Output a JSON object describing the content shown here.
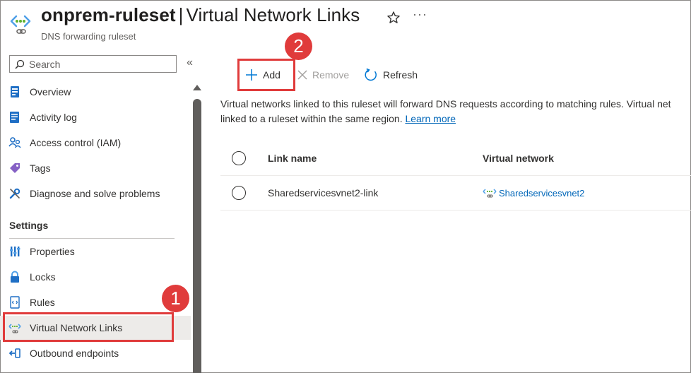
{
  "header": {
    "resource_name": "onprem-ruleset",
    "separator": "|",
    "page_name": "Virtual Network Links",
    "subtitle": "DNS forwarding ruleset",
    "more_label": "···"
  },
  "sidebar": {
    "search_placeholder": "Search",
    "collapse_label": "«",
    "items": [
      {
        "label": "Overview",
        "icon": "overview-icon"
      },
      {
        "label": "Activity log",
        "icon": "activity-log-icon"
      },
      {
        "label": "Access control (IAM)",
        "icon": "iam-icon"
      },
      {
        "label": "Tags",
        "icon": "tag-icon"
      },
      {
        "label": "Diagnose and solve problems",
        "icon": "wrench-icon"
      }
    ],
    "settings_title": "Settings",
    "settings_items": [
      {
        "label": "Properties",
        "icon": "properties-icon"
      },
      {
        "label": "Locks",
        "icon": "lock-icon"
      },
      {
        "label": "Rules",
        "icon": "rules-icon"
      },
      {
        "label": "Virtual Network Links",
        "icon": "vnet-link-icon",
        "active": true
      },
      {
        "label": "Outbound endpoints",
        "icon": "outbound-endpoint-icon"
      }
    ]
  },
  "toolbar": {
    "add_label": "Add",
    "remove_label": "Remove",
    "refresh_label": "Refresh"
  },
  "content": {
    "description_line1": "Virtual networks linked to this ruleset will forward DNS requests according to matching rules. Virtual net",
    "description_line2": "linked to a ruleset within the same region.",
    "learn_more": "Learn more"
  },
  "table": {
    "columns": [
      "Link name",
      "Virtual network"
    ],
    "rows": [
      {
        "link_name": "Sharedservicesvnet2-link",
        "virtual_network": "Sharedservicesvnet2"
      }
    ]
  },
  "callouts": {
    "step1": "1",
    "step2": "2"
  },
  "colors": {
    "accent": "#0066b8",
    "callout": "#e03b3b",
    "active_bg": "#edebe9"
  }
}
